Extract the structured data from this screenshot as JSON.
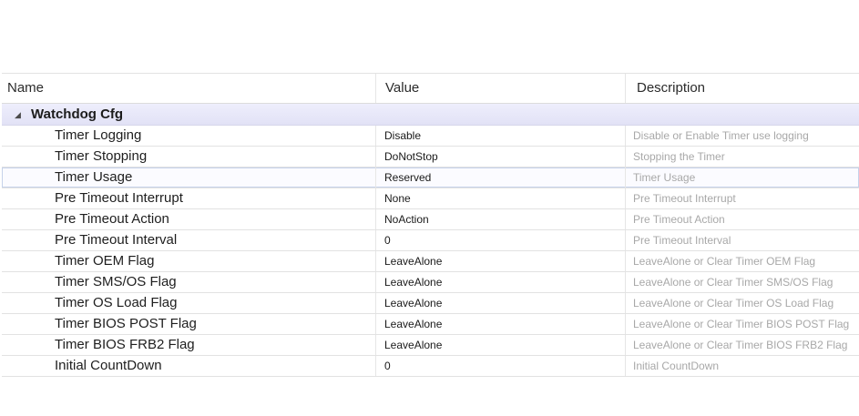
{
  "columns": {
    "name": "Name",
    "value": "Value",
    "description": "Description"
  },
  "group": {
    "expander_icon": "collapse-triangle-icon",
    "expander_glyph": "◢",
    "label": "Watchdog Cfg"
  },
  "rows": [
    {
      "name": "Timer Logging",
      "value": "Disable",
      "description": "Disable or Enable Timer use logging"
    },
    {
      "name": "Timer Stopping",
      "value": "DoNotStop",
      "description": "Stopping the Timer"
    },
    {
      "name": "Timer Usage",
      "value": "Reserved",
      "description": "Timer Usage",
      "selected": true
    },
    {
      "name": "Pre Timeout Interrupt",
      "value": "None",
      "description": "Pre Timeout Interrupt"
    },
    {
      "name": "Pre Timeout Action",
      "value": "NoAction",
      "description": "Pre Timeout Action"
    },
    {
      "name": "Pre Timeout Interval",
      "value": "0",
      "description": "Pre Timeout Interval"
    },
    {
      "name": "Timer OEM Flag",
      "value": "LeaveAlone",
      "description": "LeaveAlone or Clear Timer OEM Flag"
    },
    {
      "name": "Timer SMS/OS Flag",
      "value": "LeaveAlone",
      "description": "LeaveAlone or Clear Timer SMS/OS Flag"
    },
    {
      "name": "Timer OS Load Flag",
      "value": "LeaveAlone",
      "description": "LeaveAlone or Clear Timer OS Load Flag"
    },
    {
      "name": "Timer BIOS POST Flag",
      "value": "LeaveAlone",
      "description": "LeaveAlone or Clear Timer BIOS POST Flag"
    },
    {
      "name": "Timer BIOS FRB2 Flag",
      "value": "LeaveAlone",
      "description": "LeaveAlone or Clear Timer BIOS FRB2 Flag"
    },
    {
      "name": "Initial CountDown",
      "value": "0",
      "description": "Initial CountDown"
    }
  ]
}
